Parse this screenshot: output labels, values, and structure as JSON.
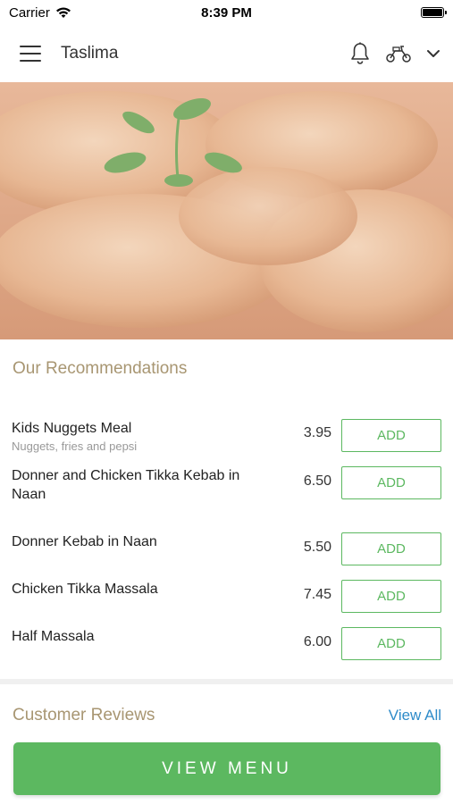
{
  "status_bar": {
    "carrier": "Carrier",
    "time": "8:39 PM"
  },
  "header": {
    "title": "Taslima",
    "icons": [
      "menu-icon",
      "bell-icon",
      "scooter-icon",
      "chevron-down-icon"
    ]
  },
  "hero": {
    "image": "curry-chicken-dish"
  },
  "recommendations": {
    "title": "Our Recommendations",
    "items": [
      {
        "name": "Kids Nuggets Meal",
        "description": "Nuggets, fries and pepsi",
        "price": "3.95",
        "add_label": "ADD"
      },
      {
        "name": "Donner and Chicken Tikka Kebab in Naan",
        "description": "",
        "price": "6.50",
        "add_label": "ADD"
      },
      {
        "name": "Donner Kebab in Naan",
        "description": "",
        "price": "5.50",
        "add_label": "ADD"
      },
      {
        "name": "Chicken Tikka Massala",
        "description": "",
        "price": "7.45",
        "add_label": "ADD"
      },
      {
        "name": "Half Massala",
        "description": "",
        "price": "6.00",
        "add_label": "ADD"
      }
    ]
  },
  "reviews": {
    "title": "Customer Reviews",
    "view_all_label": "View All"
  },
  "footer": {
    "view_menu_label": "VIEW MENU"
  },
  "colors": {
    "accent_green": "#5cb860",
    "section_title": "#a89672",
    "link_blue": "#2e8bc9"
  }
}
